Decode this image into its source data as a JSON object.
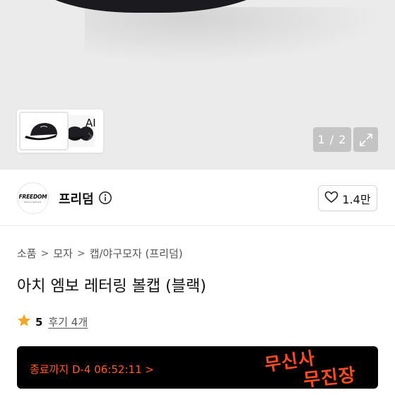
{
  "gallery": {
    "ai_label": "AI",
    "counter": "1 / 2",
    "icons": {
      "ai_chevron": "chevron-right-icon",
      "expand": "expand-icon"
    }
  },
  "brand": {
    "logo_text": "FREEDOM",
    "logo_subtext": "HOLLYWOOD",
    "name": "프리덤",
    "info_icon": "info-icon",
    "like_icon": "heart-outline-icon",
    "like_count": "1.4만"
  },
  "breadcrumb": [
    "소품",
    "모자",
    "캡/야구모자 (프리덤)"
  ],
  "product": {
    "title": "아치 엠보 레터링 볼캡 (블랙)",
    "rating": "5",
    "reviews": "후기 4개",
    "star_color": "#f5a623"
  },
  "banner": {
    "countdown": "종료까지 D-4 06:52:11 >",
    "art_line1": "무신사",
    "art_line2": "무진장",
    "accent_color": "#ff4b1f"
  }
}
